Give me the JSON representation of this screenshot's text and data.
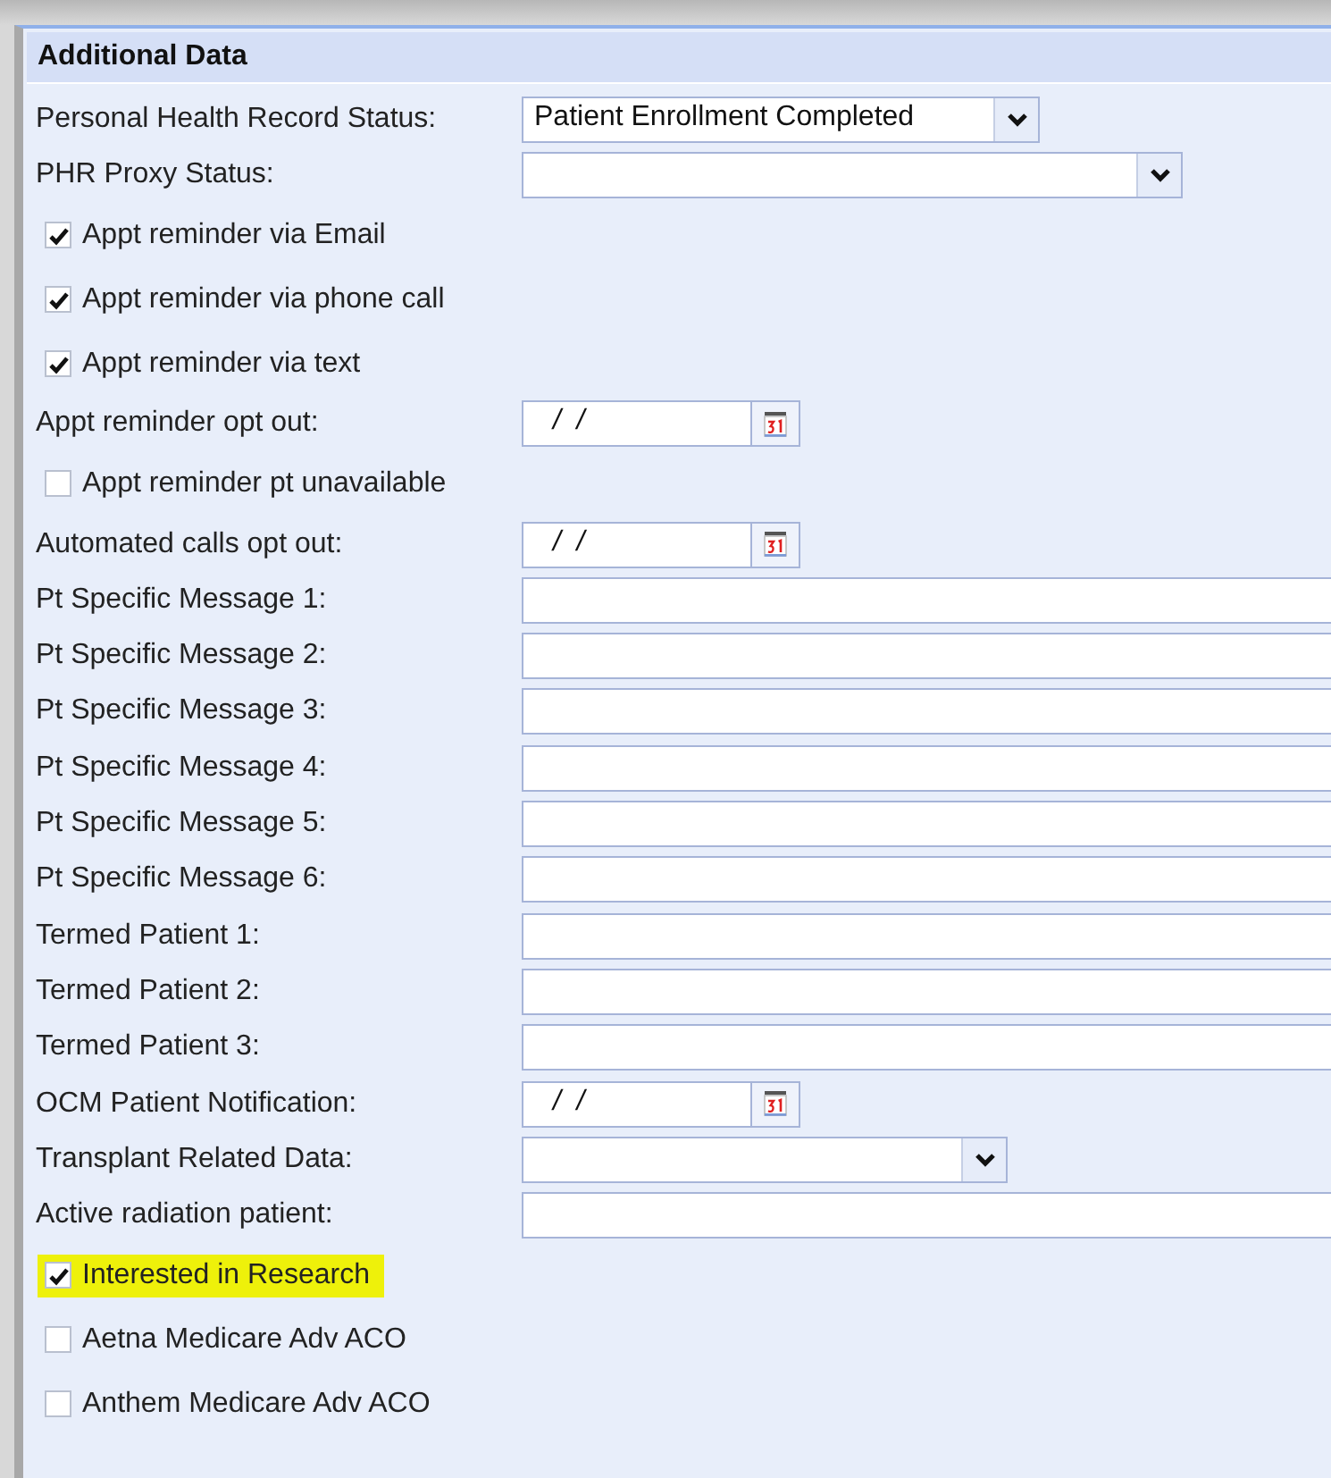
{
  "panel": {
    "title": "Additional Data"
  },
  "rows": [
    {
      "kind": "select",
      "label": "Personal Health Record Status:",
      "value": "Patient Enrollment Completed"
    },
    {
      "kind": "select",
      "label": "PHR Proxy Status:"
    },
    {
      "kind": "checkbox",
      "label": "Appt reminder via Email",
      "checked": true,
      "highlighted": false
    },
    {
      "kind": "checkbox",
      "label": "Appt reminder via phone call",
      "checked": true,
      "highlighted": false
    },
    {
      "kind": "checkbox",
      "label": "Appt reminder via text",
      "checked": true,
      "highlighted": false
    },
    {
      "kind": "date",
      "label": "Appt reminder opt out:",
      "value": " /  /"
    },
    {
      "kind": "checkbox",
      "label": "Appt reminder pt unavailable",
      "checked": false,
      "highlighted": false
    },
    {
      "kind": "date",
      "label": "Automated calls opt out:",
      "value": " /  /"
    },
    {
      "kind": "text",
      "label": "Pt Specific Message 1:"
    },
    {
      "kind": "text",
      "label": "Pt Specific Message 2:"
    },
    {
      "kind": "text",
      "label": "Pt Specific Message 3:"
    },
    {
      "kind": "text",
      "label": "Pt Specific Message 4:"
    },
    {
      "kind": "text",
      "label": "Pt Specific Message 5:"
    },
    {
      "kind": "text",
      "label": "Pt Specific Message 6:"
    },
    {
      "kind": "text",
      "label": "Termed Patient 1:"
    },
    {
      "kind": "text",
      "label": "Termed Patient 2:"
    },
    {
      "kind": "text",
      "label": "Termed Patient 3:"
    },
    {
      "kind": "date",
      "label": "OCM Patient Notification:",
      "value": " /  /"
    },
    {
      "kind": "select",
      "label": "Transplant Related Data:"
    },
    {
      "kind": "text",
      "label": "Active radiation patient:"
    },
    {
      "kind": "checkbox",
      "label": "Interested in Research",
      "checked": true,
      "highlighted": true
    },
    {
      "kind": "checkbox",
      "label": "Aetna Medicare Adv ACO",
      "checked": false,
      "highlighted": false
    },
    {
      "kind": "checkbox",
      "label": "Anthem Medicare Adv ACO",
      "checked": false,
      "highlighted": false
    }
  ]
}
